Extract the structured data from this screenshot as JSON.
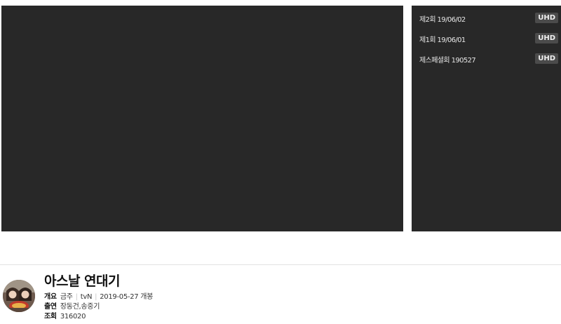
{
  "episodes": [
    {
      "title": "제2회 19/06/02",
      "badge": "UHD"
    },
    {
      "title": "제1회 19/06/01",
      "badge": "UHD"
    },
    {
      "title": "제스페셜회 190527",
      "badge": "UHD"
    }
  ],
  "program": {
    "title": "아스날 연대기",
    "overview_label": "개요",
    "schedule": "금주",
    "channel": "tvN",
    "release": "2019-05-27 개봉",
    "cast_label": "출연",
    "cast": "장동건,송중기",
    "views_label": "조회",
    "views": "316020"
  }
}
